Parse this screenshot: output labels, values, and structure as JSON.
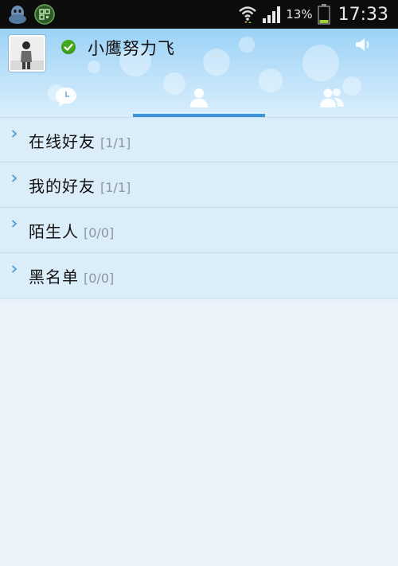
{
  "status_bar": {
    "icons": [
      "qq-penguin-icon",
      "app-qr-icon",
      "wifi-icon",
      "signal-icon",
      "battery-icon"
    ],
    "battery_percent": "13%",
    "time": "17:33"
  },
  "profile": {
    "nickname": "小鹰努力飞",
    "status_icon": "online-check-icon",
    "speaker_icon": "speaker-icon",
    "status_color": "#43a81c"
  },
  "tabs": [
    {
      "id": "chat",
      "icon": "chat-bubble-icon",
      "active": false
    },
    {
      "id": "contacts",
      "icon": "person-icon",
      "active": true
    },
    {
      "id": "groups",
      "icon": "group-people-icon",
      "active": false
    }
  ],
  "groups": [
    {
      "name": "在线好友",
      "count": "[1/1]"
    },
    {
      "name": "我的好友",
      "count": "[1/1]"
    },
    {
      "name": "陌生人",
      "count": "[0/0]"
    },
    {
      "name": "黑名单",
      "count": "[0/0]"
    }
  ],
  "colors": {
    "accent": "#3c95db",
    "header_top": "#9bd2f6",
    "row_bg": "#dcedfa",
    "page_bg": "#eaf2fa"
  }
}
